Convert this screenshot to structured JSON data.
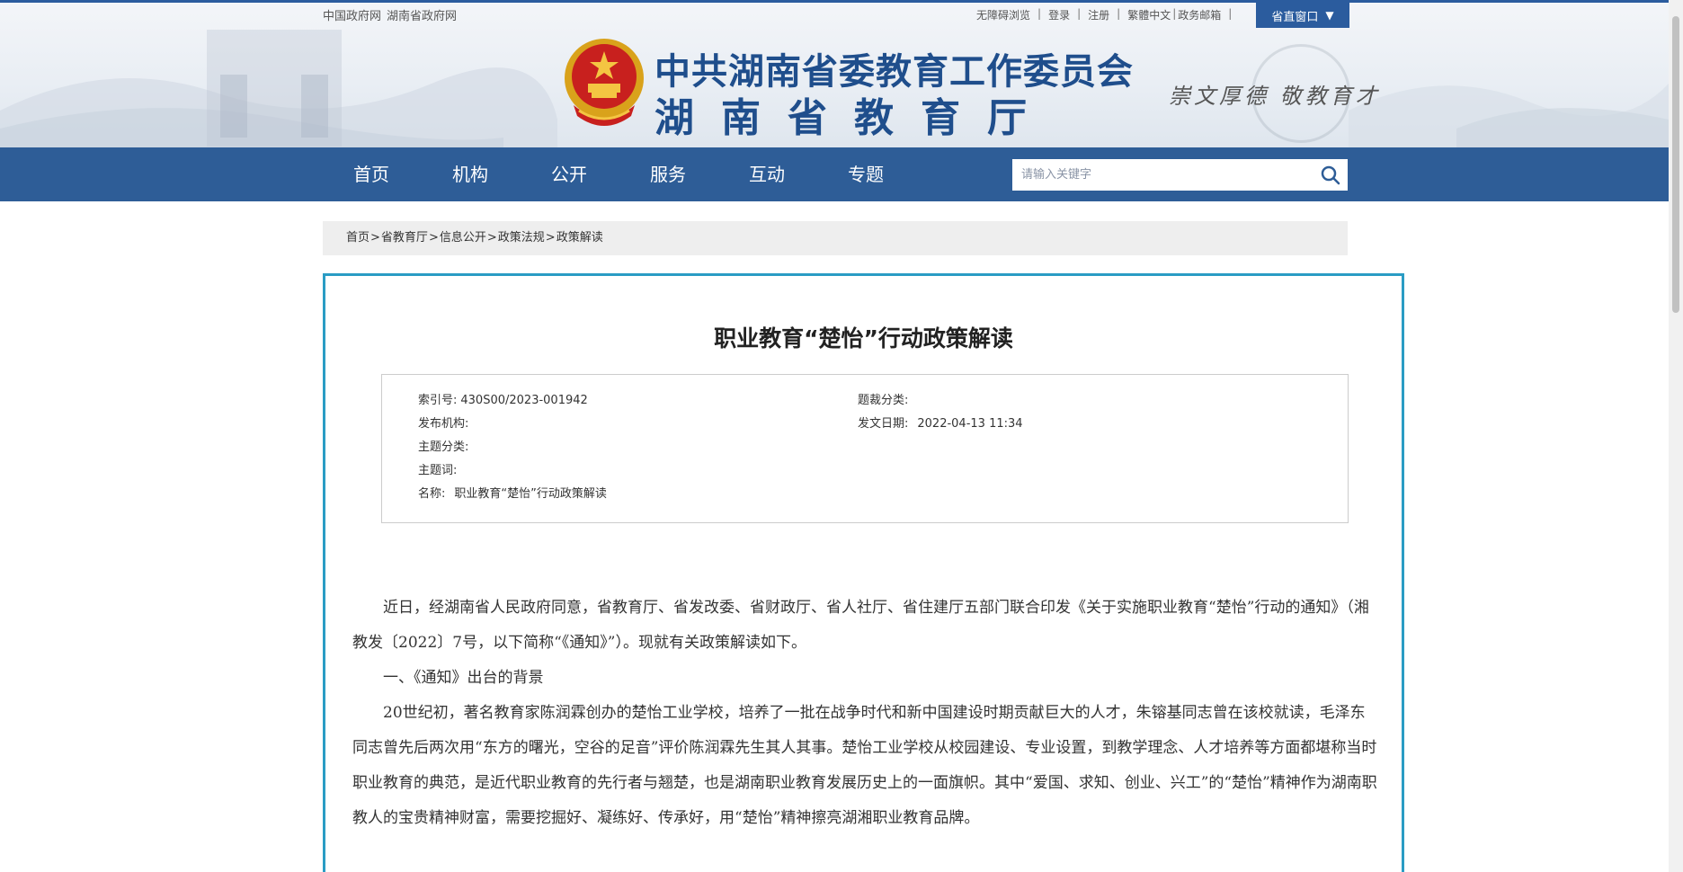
{
  "top_links_left": [
    "中国政府网",
    "湖南省政府网"
  ],
  "top_links_right": [
    "无障碍浏览",
    "登录",
    "注册",
    "繁體中文",
    "政务邮箱"
  ],
  "dept_button": {
    "label": "省直窗口",
    "icon": "triangle-down-icon"
  },
  "header": {
    "title_line1": "中共湖南省委教育工作委员会",
    "title_line2": "湖南省教育厅",
    "slogan": "崇文厚德  敬教育才"
  },
  "nav": {
    "items": [
      "首页",
      "机构",
      "公开",
      "服务",
      "互动",
      "专题"
    ],
    "search_placeholder": "请输入关键字",
    "search_icon": "search-icon"
  },
  "breadcrumb": [
    "首页",
    "省教育厅",
    "信息公开",
    "政策法规",
    "政策解读"
  ],
  "article": {
    "title": "职业教育“楚怡”行动政策解读",
    "meta": {
      "index_label": "索引号:",
      "index_value": "430S00/2023-001942",
      "genre_label": "题裁分类:",
      "genre_value": "",
      "publisher_label": "发布机构:",
      "publisher_value": "",
      "date_label": "发文日期:",
      "date_value": "2022-04-13 11:34",
      "topic_label": "主题分类:",
      "topic_value": "",
      "keywords_label": "主题词:",
      "keywords_value": "",
      "name_label": "名称:",
      "name_value": "职业教育“楚怡”行动政策解读"
    },
    "paragraphs": [
      "近日，经湖南省人民政府同意，省教育厅、省发改委、省财政厅、省人社厅、省住建厅五部门联合印发《关于实施职业教育“楚怡”行动的通知》（湘教发〔2022〕7号，以下简称“《通知》”）。现就有关政策解读如下。",
      "一、《通知》出台的背景",
      "20世纪初，著名教育家陈润霖创办的楚怡工业学校，培养了一批在战争时代和新中国建设时期贡献巨大的人才，朱镕基同志曾在该校就读，毛泽东同志曾先后两次用“东方的曙光，空谷的足音”评价陈润霖先生其人其事。楚怡工业学校从校园建设、专业设置，到教学理念、人才培养等方面都堪称当时职业教育的典范，是近代职业教育的先行者与翘楚，也是湖南职业教育发展历史上的一面旗帜。其中“爱国、求知、创业、兴工”的“楚怡”精神作为湖南职教人的宝贵精神财富，需要挖掘好、凝练好、传承好，用“楚怡”精神擦亮湖湘职业教育品牌。"
    ]
  },
  "colors": {
    "nav_bg": "#2e5d97",
    "title_blue": "#1f4e8c",
    "card_border": "#2a9cc4",
    "breadcrumb_bg": "#eeeeee"
  }
}
